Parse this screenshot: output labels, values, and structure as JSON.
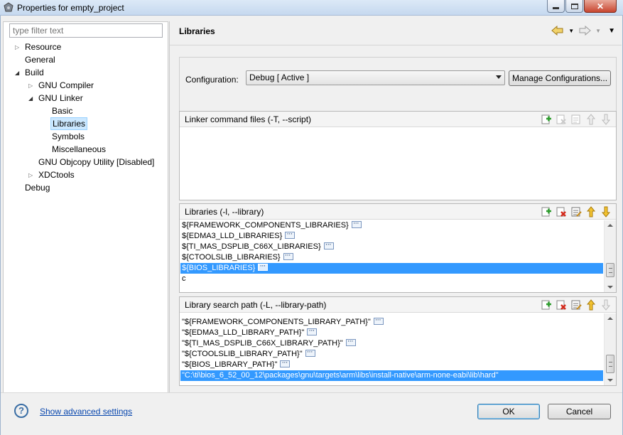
{
  "window": {
    "title": "Properties for empty_project",
    "controls": [
      "minimize-icon",
      "maximize-icon",
      "close-icon"
    ]
  },
  "filter": {
    "placeholder": "type filter text"
  },
  "tree": [
    {
      "label": "Resource",
      "expander": "collapsed"
    },
    {
      "label": "General",
      "expander": "none"
    },
    {
      "label": "Build",
      "expander": "expanded"
    },
    {
      "label": "GNU Compiler",
      "expander": "collapsed"
    },
    {
      "label": "GNU Linker",
      "expander": "expanded"
    },
    {
      "label": "Basic",
      "expander": "none"
    },
    {
      "label": "Libraries",
      "expander": "none",
      "selected": true
    },
    {
      "label": "Symbols",
      "expander": "none"
    },
    {
      "label": "Miscellaneous",
      "expander": "none"
    },
    {
      "label": "GNU Objcopy Utility  [Disabled]",
      "expander": "none"
    },
    {
      "label": "XDCtools",
      "expander": "collapsed"
    },
    {
      "label": "Debug",
      "expander": "none"
    }
  ],
  "page": {
    "title": "Libraries",
    "nav_icons": [
      "back-arrow-icon",
      "forward-arrow-icon",
      "view-menu-icon"
    ]
  },
  "configuration": {
    "label": "Configuration:",
    "value": "Debug  [ Active ]",
    "manage_button": "Manage Configurations..."
  },
  "linker_cmd": {
    "title": "Linker command files (-T, --script)",
    "tools": [
      "add-icon",
      "delete-icon",
      "edit-icon",
      "move-up-icon",
      "move-down-icon"
    ],
    "items": []
  },
  "libraries": {
    "title": "Libraries (-l, --library)",
    "tools": [
      "add-icon",
      "delete-icon",
      "edit-icon",
      "move-up-icon",
      "move-down-icon"
    ],
    "items": [
      {
        "text": "${FRAMEWORK_COMPONENTS_LIBRARIES}",
        "dots": true
      },
      {
        "text": "${EDMA3_LLD_LIBRARIES}",
        "dots": true
      },
      {
        "text": "${TI_MAS_DSPLIB_C66X_LIBRARIES}",
        "dots": true
      },
      {
        "text": "${CTOOLSLIB_LIBRARIES}",
        "dots": true
      },
      {
        "text": "${BIOS_LIBRARIES}",
        "dots": true,
        "selected": true
      },
      {
        "text": "c",
        "dots": false
      }
    ]
  },
  "search_path": {
    "title": "Library search path (-L, --library-path)",
    "tools": [
      "add-icon",
      "delete-icon",
      "edit-icon",
      "move-up-icon",
      "move-down-icon"
    ],
    "items": [
      {
        "text": "\"${FRAMEWORK_COMPONENTS_LIBRARY_PATH}\"",
        "dots": true
      },
      {
        "text": "\"${EDMA3_LLD_LIBRARY_PATH}\"",
        "dots": true
      },
      {
        "text": "\"${TI_MAS_DSPLIB_C66X_LIBRARY_PATH}\"",
        "dots": true
      },
      {
        "text": "\"${CTOOLSLIB_LIBRARY_PATH}\"",
        "dots": true
      },
      {
        "text": "\"${BIOS_LIBRARY_PATH}\"",
        "dots": true
      },
      {
        "text": "\"C:\\ti\\bios_6_52_00_12\\packages\\gnu\\targets\\arm\\libs\\install-native\\arm-none-eabi\\lib\\hard\"",
        "dots": false,
        "selected": true
      }
    ]
  },
  "footer": {
    "help_glyph": "?",
    "advanced_link": "Show advanced settings",
    "ok": "OK",
    "cancel": "Cancel"
  }
}
